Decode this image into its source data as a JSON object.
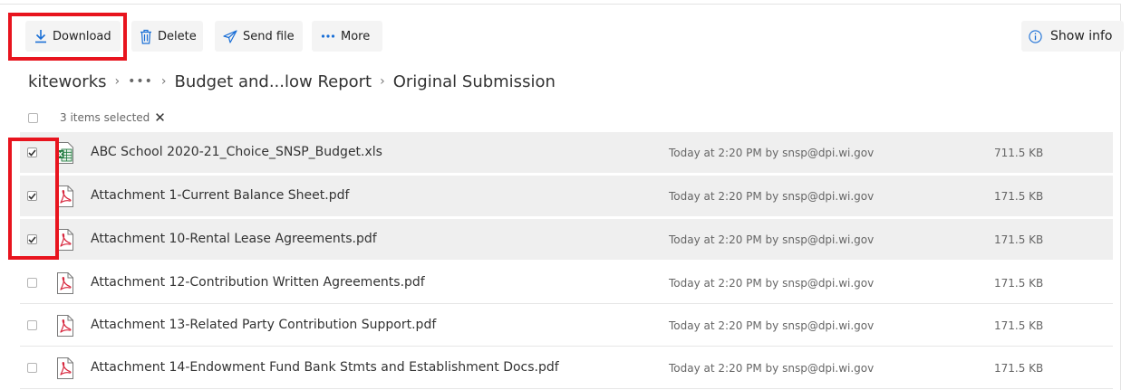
{
  "toolbar": {
    "download_label": "Download",
    "delete_label": "Delete",
    "send_label": "Send file",
    "more_label": "More",
    "info_label": "Show info"
  },
  "breadcrumb": {
    "root": "kiteworks",
    "folder": "Budget and...low Report",
    "current": "Original Submission"
  },
  "selection": {
    "label": "3 items selected"
  },
  "files": [
    {
      "name": "ABC School 2020-21_Choice_SNSP_Budget.xls",
      "type": "excel",
      "modified": "Today at 2:20 PM by snsp@dpi.wi.gov",
      "size": "711.5 KB",
      "selected": true
    },
    {
      "name": "Attachment 1-Current Balance Sheet.pdf",
      "type": "pdf",
      "modified": "Today at 2:20 PM by snsp@dpi.wi.gov",
      "size": "171.5 KB",
      "selected": true
    },
    {
      "name": "Attachment 10-Rental Lease Agreements.pdf",
      "type": "pdf",
      "modified": "Today at 2:20 PM by snsp@dpi.wi.gov",
      "size": "171.5 KB",
      "selected": true
    },
    {
      "name": "Attachment 12-Contribution Written Agreements.pdf",
      "type": "pdf",
      "modified": "Today at 2:20 PM by snsp@dpi.wi.gov",
      "size": "171.5 KB",
      "selected": false
    },
    {
      "name": "Attachment 13-Related Party Contribution Support.pdf",
      "type": "pdf",
      "modified": "Today at 2:20 PM by snsp@dpi.wi.gov",
      "size": "171.5 KB",
      "selected": false
    },
    {
      "name": "Attachment 14-Endowment Fund Bank Stmts and Establishment Docs.pdf",
      "type": "pdf",
      "modified": "Today at 2:20 PM by snsp@dpi.wi.gov",
      "size": "171.5 KB",
      "selected": false
    }
  ],
  "colors": {
    "accent": "#1a6fd6",
    "highlight": "#e8141e",
    "pdf_red": "#d7263d",
    "excel_green": "#1f7a3e"
  },
  "icons": {
    "download": "download-icon",
    "delete": "trash-icon",
    "send": "send-icon",
    "more": "more-dots-icon",
    "info": "info-icon",
    "breadcrumb_separator": "chevron-right-icon",
    "close": "close-icon",
    "pdf": "pdf-file-icon",
    "excel": "excel-file-icon"
  }
}
